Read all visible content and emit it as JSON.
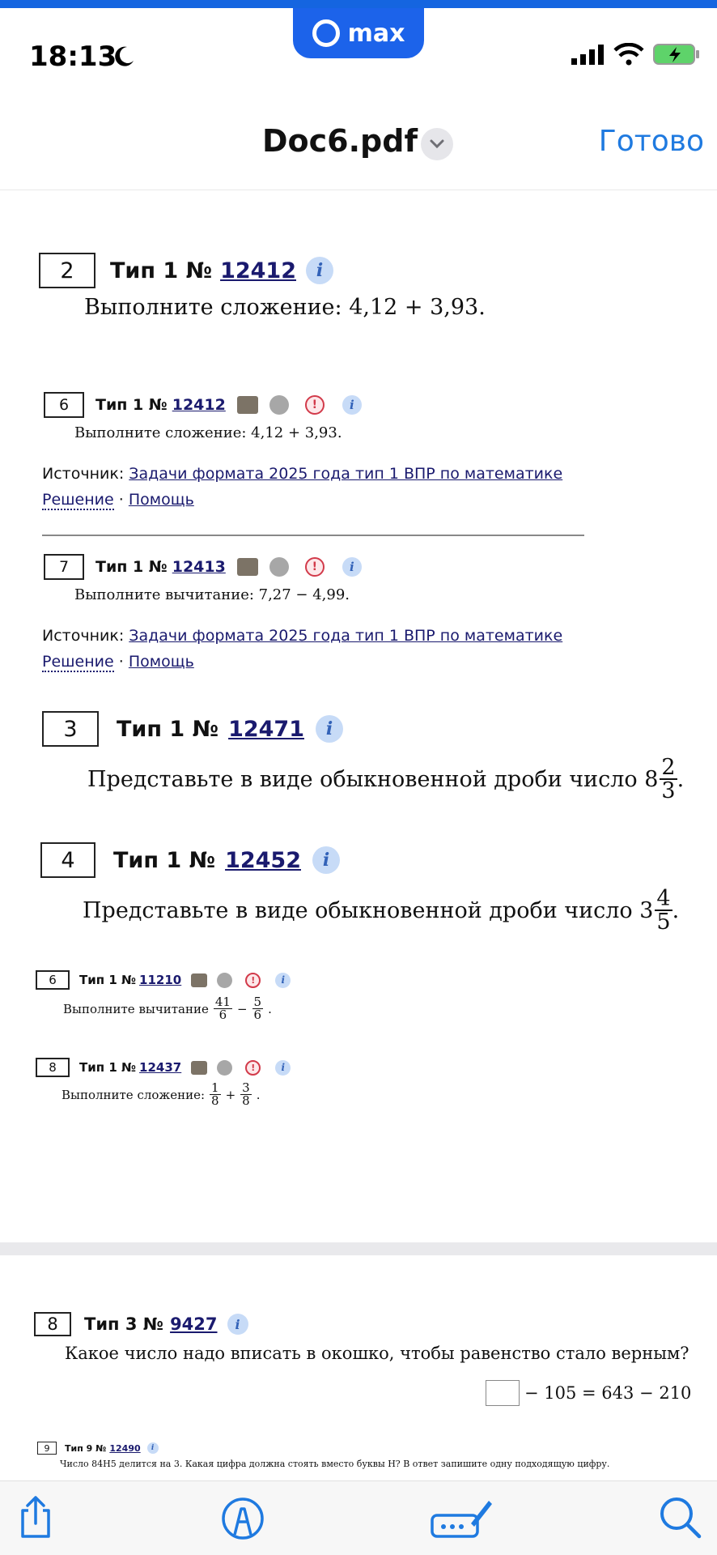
{
  "status": {
    "time": "18:13",
    "app_badge": "max"
  },
  "nav": {
    "title": "Doc6.pdf",
    "done": "Готово"
  },
  "tasks": {
    "t1": {
      "num": "2",
      "type": "Тип 1 №",
      "id": "12412",
      "text": "Выполните сложение: 4,12 + 3,93."
    },
    "t2": {
      "num": "6",
      "type": "Тип 1 №",
      "id": "12412",
      "text": "Выполните сложение: 4,12 + 3,93."
    },
    "t3": {
      "num": "7",
      "type": "Тип 1 №",
      "id": "12413",
      "text": "Выполните вычитание: 7,27 − 4,99."
    },
    "t4": {
      "num": "3",
      "type": "Тип 1 №",
      "id": "12471",
      "text": "Представьте в виде обыкновенной дроби число 8",
      "frac_n": "2",
      "frac_d": "3"
    },
    "t5": {
      "num": "4",
      "type": "Тип 1 №",
      "id": "12452",
      "text": "Представьте в виде обыкновенной дроби число 3",
      "frac_n": "4",
      "frac_d": "5"
    },
    "t6": {
      "num": "6",
      "type": "Тип 1 №",
      "id": "11210",
      "text": "Выполните вычитание",
      "a_n": "41",
      "a_d": "6",
      "b_n": "5",
      "b_d": "6"
    },
    "t7": {
      "num": "8",
      "type": "Тип 1 №",
      "id": "12437",
      "text": "Выполните сложение:",
      "a_n": "1",
      "a_d": "8",
      "b_n": "3",
      "b_d": "8"
    },
    "t8": {
      "num": "8",
      "type": "Тип 3 №",
      "id": "9427",
      "text": "Какое число надо вписать в окошко, чтобы равенство стало верным?",
      "eq": "− 105 = 643 − 210"
    },
    "t9": {
      "num": "9",
      "type": "Тип 9 №",
      "id": "12490",
      "text": "Число 84H5 делится на 3. Какая цифра должна стоять вместо буквы H? В ответ запишите одну подходящую цифру."
    }
  },
  "source": {
    "label": "Источник:",
    "link": "Задачи формата 2025 года тип 1 ВПР по математике",
    "solution": "Решение",
    "sep": "·",
    "help": "Помощь"
  },
  "icons": {
    "info": "i",
    "warn": "!"
  },
  "colors": {
    "accent": "#1f7ae0",
    "max_brand": "#1c63ea",
    "link": "#1a1a6e"
  }
}
